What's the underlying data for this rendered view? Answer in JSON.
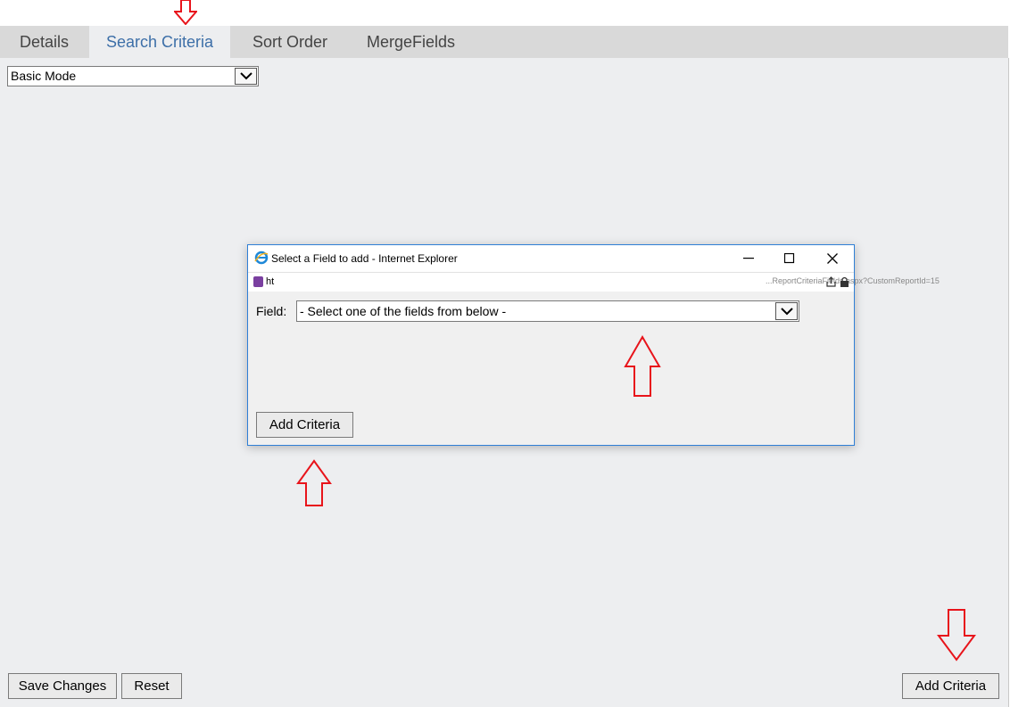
{
  "tabs": [
    {
      "label": "Details",
      "active": false
    },
    {
      "label": "Search Criteria",
      "active": true
    },
    {
      "label": "Sort Order",
      "active": false
    },
    {
      "label": "MergeFields",
      "active": false
    }
  ],
  "mode_select": {
    "value": "Basic Mode"
  },
  "dialog": {
    "title": "Select a Field to add - Internet Explorer",
    "url_prefix": "ht",
    "url_tail": "...ReportCriteriaFields.aspx?CustomReportId=15",
    "field_label": "Field:",
    "field_select_value": "- Select one of the fields from below -",
    "add_button": "Add Criteria"
  },
  "footer": {
    "save_button": "Save Changes",
    "reset_button": "Reset",
    "add_criteria_button": "Add Criteria"
  },
  "colors": {
    "annotation_arrow": "#e8141b",
    "active_tab_text": "#3d6fa8",
    "dialog_border": "#2f7fd6"
  }
}
